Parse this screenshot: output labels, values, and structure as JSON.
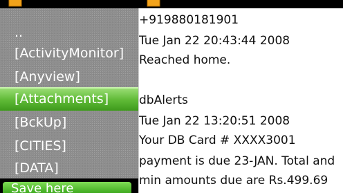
{
  "file_browser": {
    "items": [
      {
        "label": ".."
      },
      {
        "label": "[ActivityMonitor]"
      },
      {
        "label": "[Anyview]"
      },
      {
        "label": "[Attachments]",
        "selected": true
      },
      {
        "label": "[BckUp]"
      },
      {
        "label": "[CITIES]"
      },
      {
        "label": "[DATA]"
      }
    ]
  },
  "message_view": {
    "lines": [
      "+919880181901",
      "Tue Jan 22 20:43:44 2008",
      "Reached home.",
      "",
      "dbAlerts",
      "Tue Jan 22 13:20:51 2008",
      "Your DB Card # XXXX3001",
      "payment is due 23-JAN. Total and",
      "min amounts due are Rs.499.69"
    ]
  },
  "softkeys": {
    "left_label": "Save here"
  },
  "colors": {
    "selection_green": "#5fba36",
    "pane_gray": "#8e8e8e",
    "folder_orange": "#f2a31b"
  },
  "icons": [
    "folder-icon"
  ]
}
